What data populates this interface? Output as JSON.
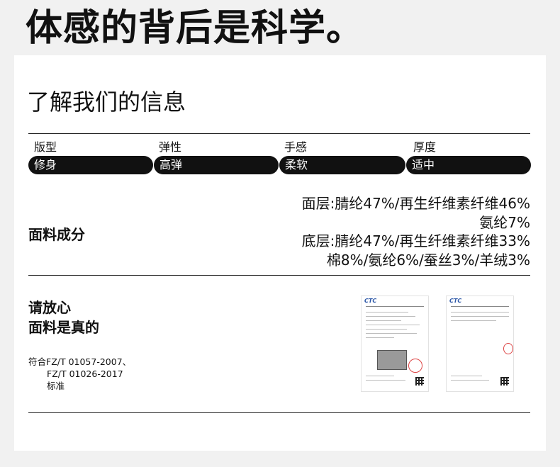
{
  "headline": "体感的背后是科学。",
  "section_title": "了解我们的信息",
  "attributes": [
    {
      "label": "版型",
      "value": "修身"
    },
    {
      "label": "弹性",
      "value": "高弹"
    },
    {
      "label": "手感",
      "value": "柔软"
    },
    {
      "label": "厚度",
      "value": "适中"
    }
  ],
  "fabric": {
    "label": "面料成分",
    "lines": [
      "面层:腈纶47%/再生纤维素纤维46%",
      "氨纶7%",
      "底层:腈纶47%/再生纤维素纤维33%",
      "棉8%/氨纶6%/蚕丝3%/羊绒3%"
    ]
  },
  "assurance": {
    "line1": "请放心",
    "line2": "面料是真的",
    "standard_line1": "符合FZ/T 01057-2007、",
    "standard_line2": "FZ/T 01026-2017",
    "standard_line3": "标准"
  },
  "colors": {
    "pill_bg": "#111111",
    "pill_text": "#ffffff",
    "page_bg": "#f1f1f1",
    "stamp": "#dd4444",
    "logo": "#2d58a8"
  },
  "icons": [
    "test-report-document",
    "qr-code-icon",
    "red-seal-stamp"
  ]
}
